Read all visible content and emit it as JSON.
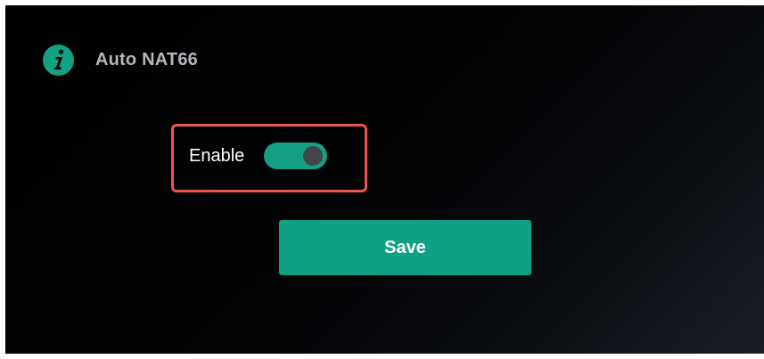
{
  "section": {
    "title": "Auto NAT66",
    "icon": "info-icon"
  },
  "enable": {
    "label": "Enable",
    "toggle_on": true
  },
  "actions": {
    "save_label": "Save"
  },
  "colors": {
    "accent": "#12a283",
    "highlight": "#e9574f",
    "background": "#000000",
    "title_text": "#b3b6bb",
    "knob": "#434648"
  }
}
